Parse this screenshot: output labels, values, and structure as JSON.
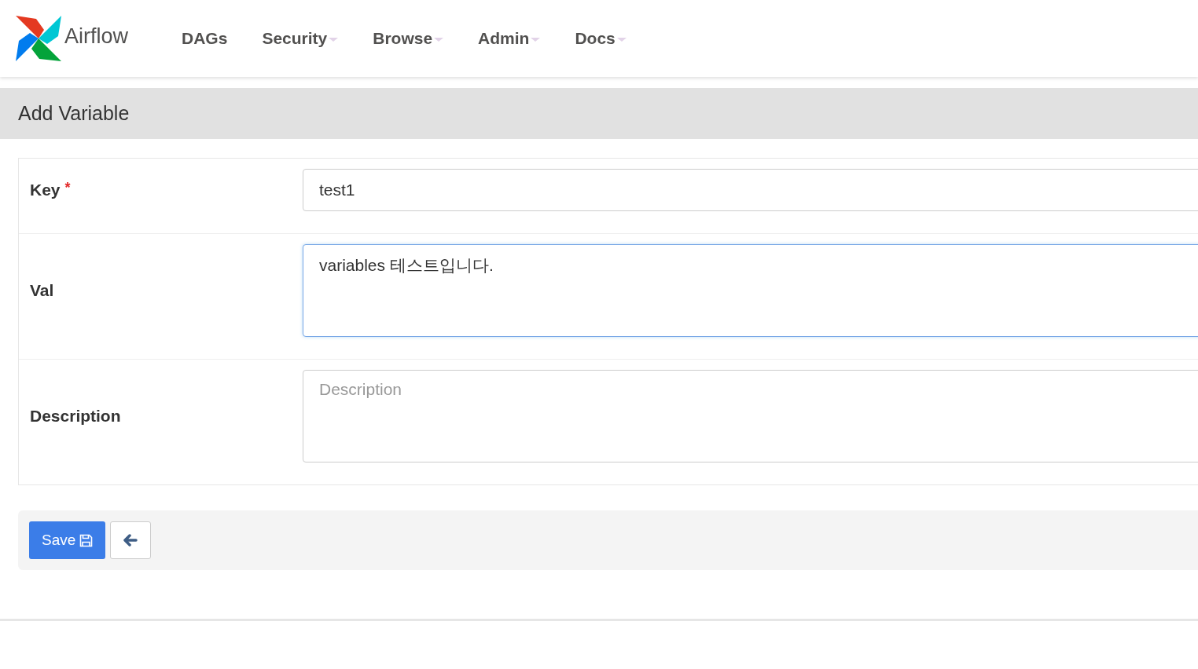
{
  "brand": "Airflow",
  "nav": [
    {
      "label": "DAGs",
      "dropdown": false
    },
    {
      "label": "Security",
      "dropdown": true
    },
    {
      "label": "Browse",
      "dropdown": true
    },
    {
      "label": "Admin",
      "dropdown": true
    },
    {
      "label": "Docs",
      "dropdown": true
    }
  ],
  "page_title": "Add Variable",
  "required_mark": "*",
  "fields": [
    {
      "label": "Key",
      "required": true,
      "kind": "input",
      "value": "test1",
      "focused": false
    },
    {
      "label": "Val",
      "required": false,
      "kind": "textarea",
      "value": "variables 테스트입니다.",
      "focused": true
    },
    {
      "label": "Description",
      "required": false,
      "kind": "textarea",
      "placeholder": "Description",
      "focused": false
    }
  ],
  "save_button": "Save"
}
